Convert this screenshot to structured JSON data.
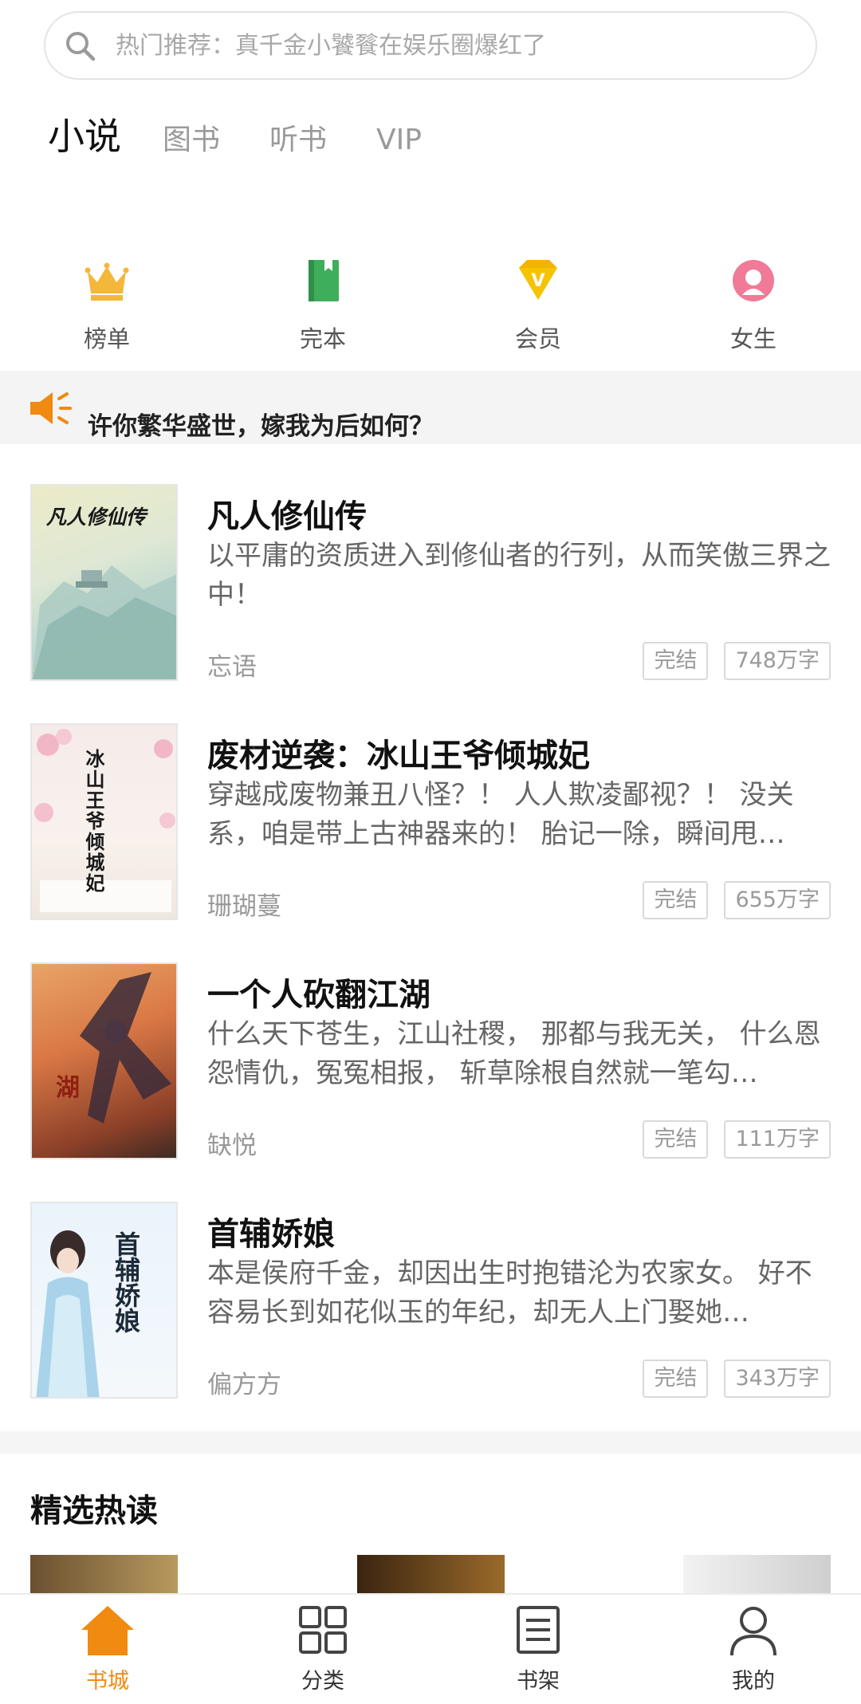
{
  "search": {
    "placeholder": "热门推荐：真千金小饕餮在娱乐圈爆红了"
  },
  "tabs": [
    "小说",
    "图书",
    "听书",
    "VIP"
  ],
  "quick_entries": [
    {
      "label": "榜单",
      "icon": "crown-icon"
    },
    {
      "label": "完本",
      "icon": "book-icon"
    },
    {
      "label": "会员",
      "icon": "vip-diamond-icon"
    },
    {
      "label": "女生",
      "icon": "female-icon"
    }
  ],
  "notice": {
    "text": "许你繁华盛世，嫁我为后如何？",
    "icon": "speaker-icon"
  },
  "books": [
    {
      "title": "凡人修仙传",
      "desc": "以平庸的资质进入到修仙者的行列，从而笑傲三界之中！",
      "author": "忘语",
      "status": "完结",
      "words": "748万字",
      "cover_text": "凡人修仙传"
    },
    {
      "title": "废材逆袭：冰山王爷倾城妃",
      "desc": "穿越成废物兼丑八怪？！ 人人欺凌鄙视？！ 没关系，咱是带上古神器来的！ 胎记一除，瞬间甩…",
      "author": "珊瑚蔓",
      "status": "完结",
      "words": "655万字",
      "cover_text": "冰山王爷倾城妃"
    },
    {
      "title": "一个人砍翻江湖",
      "desc": "什么天下苍生，江山社稷， 那都与我无关， 什么恩怨情仇，冤冤相报， 斩草除根自然就一笔勾…",
      "author": "缺悦",
      "status": "完结",
      "words": "111万字",
      "cover_text": "湖"
    },
    {
      "title": "首辅娇娘",
      "desc": "本是侯府千金，却因出生时抱错沦为农家女。 好不容易长到如花似玉的年纪，却无人上门娶她…",
      "author": "偏方方",
      "status": "完结",
      "words": "343万字",
      "cover_text": "首辅娇娘"
    }
  ],
  "section": {
    "title": "精选热读"
  },
  "nav": [
    {
      "label": "书城",
      "icon": "home-icon",
      "active": true
    },
    {
      "label": "分类",
      "icon": "grid-icon"
    },
    {
      "label": "书架",
      "icon": "bookshelf-icon"
    },
    {
      "label": "我的",
      "icon": "user-icon"
    }
  ],
  "colors": {
    "accent": "#f08a10",
    "crown": "#f4b73a",
    "book": "#3fae5a",
    "vip": "#f2b400",
    "female": "#f07a98"
  }
}
